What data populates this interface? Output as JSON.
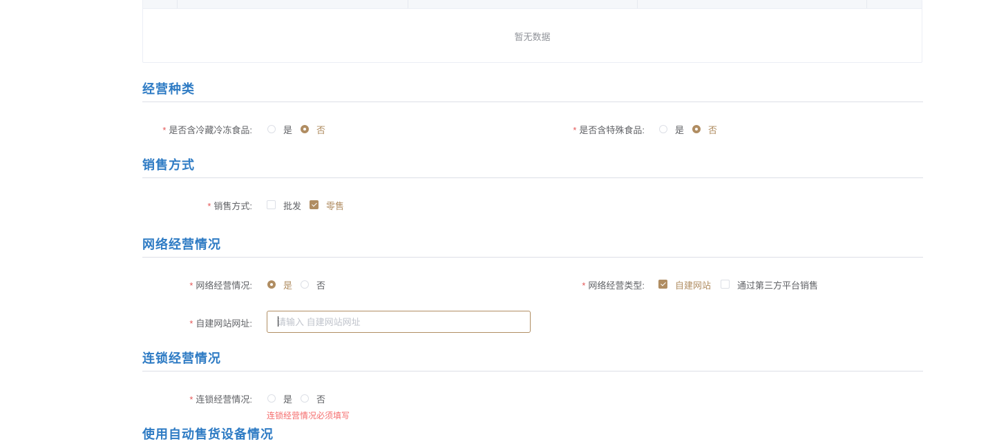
{
  "table": {
    "empty_text": "暂无数据"
  },
  "sections": {
    "business_category": {
      "title": "经营种类",
      "cold_food": {
        "label": "是否含冷藏冷冻食品:",
        "options": [
          "是",
          "否"
        ],
        "selected": "否"
      },
      "special_food": {
        "label": "是否含特殊食品:",
        "options": [
          "是",
          "否"
        ],
        "selected": "否"
      }
    },
    "sales_method": {
      "title": "销售方式",
      "method": {
        "label": "销售方式:",
        "options": [
          "批发",
          "零售"
        ],
        "checked": [
          "零售"
        ]
      }
    },
    "online_business": {
      "title": "网络经营情况",
      "status": {
        "label": "网络经营情况:",
        "options": [
          "是",
          "否"
        ],
        "selected": "是"
      },
      "type": {
        "label": "网络经营类型:",
        "options": [
          "自建网站",
          "通过第三方平台销售"
        ],
        "checked": [
          "自建网站"
        ]
      },
      "website": {
        "label": "自建网站网址:",
        "placeholder": "请输入 自建网站网址",
        "value": ""
      }
    },
    "chain_business": {
      "title": "连锁经营情况",
      "status": {
        "label": "连锁经营情况:",
        "options": [
          "是",
          "否"
        ],
        "selected": null,
        "error": "连锁经营情况必须填写"
      }
    },
    "vending": {
      "title": "使用自动售货设备情况"
    }
  },
  "required_mark": "*",
  "colors": {
    "accent": "#b08d62",
    "section_title": "#2e7bc4",
    "error": "#f56c6c",
    "required": "#e45656"
  }
}
